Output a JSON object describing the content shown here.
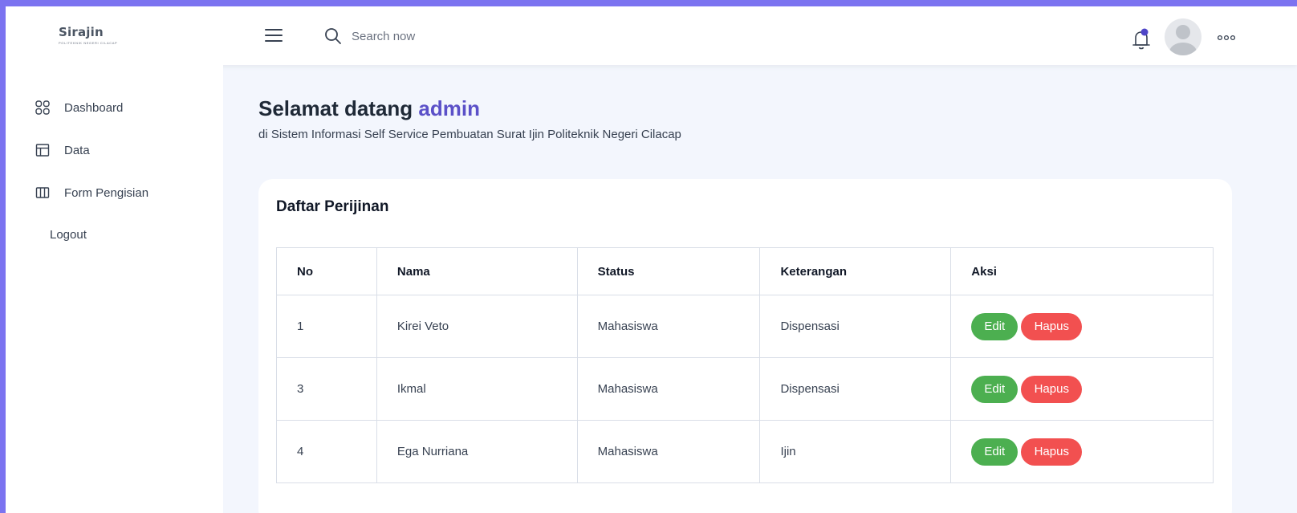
{
  "brand": {
    "title": "Sirajin",
    "subtitle": "POLITEKNIK NEGERI CILACAP"
  },
  "header": {
    "search_placeholder": "Search now",
    "icons": [
      "menu-icon",
      "search-icon",
      "bell-icon",
      "avatar",
      "more-icon"
    ],
    "notification_dot_color": "#4f46c8"
  },
  "sidebar": {
    "items": [
      {
        "label": "Dashboard",
        "icon": "dashboard-grid-icon"
      },
      {
        "label": "Data",
        "icon": "layout-icon"
      },
      {
        "label": "Form Pengisian",
        "icon": "columns-icon"
      },
      {
        "label": "Logout",
        "icon": ""
      }
    ]
  },
  "main": {
    "greeting": "Selamat datang",
    "username": "admin",
    "subtitle": "di Sistem Informasi Self Service Pembuatan Surat Ijin Politeknik Negeri Cilacap"
  },
  "table": {
    "title": "Daftar Perijinan",
    "columns": [
      "No",
      "Nama",
      "Status",
      "Keterangan",
      "Aksi"
    ],
    "rows": [
      {
        "no": "1",
        "nama": "Kirei Veto",
        "status": "Mahasiswa",
        "keterangan": "Dispensasi"
      },
      {
        "no": "3",
        "nama": "Ikmal",
        "status": "Mahasiswa",
        "keterangan": "Dispensasi"
      },
      {
        "no": "4",
        "nama": "Ega Nurriana",
        "status": "Mahasiswa",
        "keterangan": "Ijin"
      }
    ],
    "edit_label": "Edit",
    "hapus_label": "Hapus"
  },
  "colors": {
    "accent": "#5b50c8",
    "edit": "#4caf50",
    "hapus": "#f25050",
    "background": "#f3f6fd",
    "frame": "#7b73f0"
  }
}
